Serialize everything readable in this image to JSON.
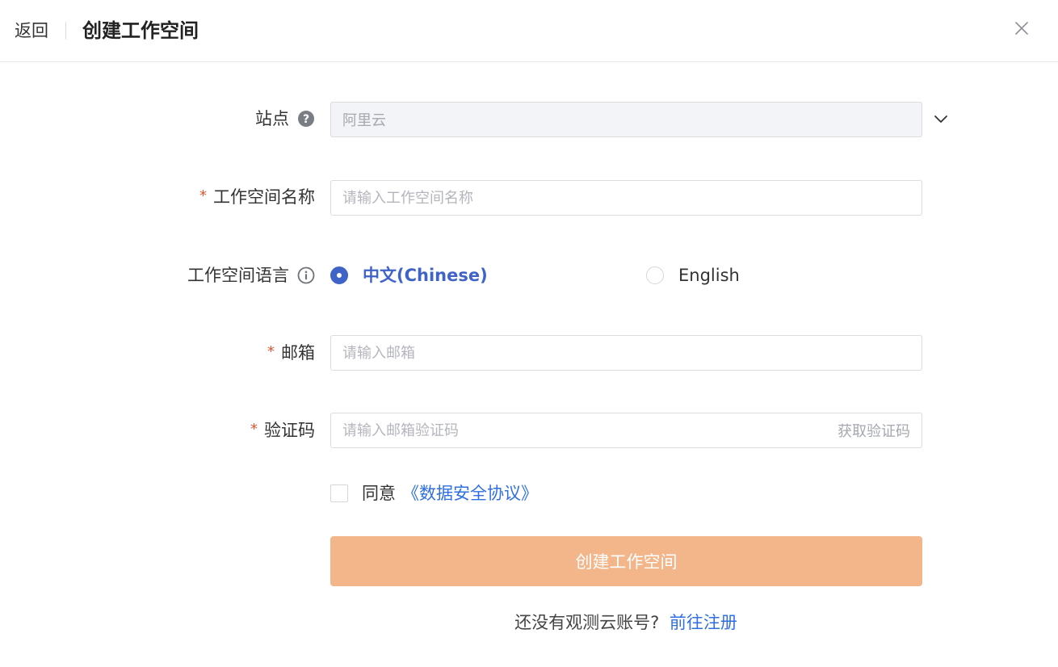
{
  "header": {
    "back_label": "返回",
    "title": "创建工作空间",
    "close_icon": "close-icon"
  },
  "form": {
    "site": {
      "label": "站点",
      "help_icon": "question-circle-icon",
      "value": "阿里云",
      "dropdown_icon": "chevron-down-icon"
    },
    "workspace_name": {
      "required_mark": "*",
      "label": "工作空间名称",
      "placeholder": "请输入工作空间名称",
      "value": ""
    },
    "language": {
      "label": "工作空间语言",
      "info_icon": "info-circle-icon",
      "options": [
        {
          "label": "中文(Chinese)",
          "selected": true
        },
        {
          "label": "English",
          "selected": false
        }
      ]
    },
    "email": {
      "required_mark": "*",
      "label": "邮箱",
      "placeholder": "请输入邮箱",
      "value": ""
    },
    "verification_code": {
      "required_mark": "*",
      "label": "验证码",
      "placeholder": "请输入邮箱验证码",
      "value": "",
      "get_code_label": "获取验证码"
    },
    "agreement": {
      "checked": false,
      "text": "同意",
      "link": "《数据安全协议》"
    },
    "submit_label": "创建工作空间"
  },
  "footer": {
    "text": "还没有观测云账号?",
    "register_link": "前往注册"
  },
  "colors": {
    "accent": "#3f63c7",
    "link": "#2f6fe3",
    "required": "#e8542b",
    "submit_bg": "#f3b68b"
  }
}
